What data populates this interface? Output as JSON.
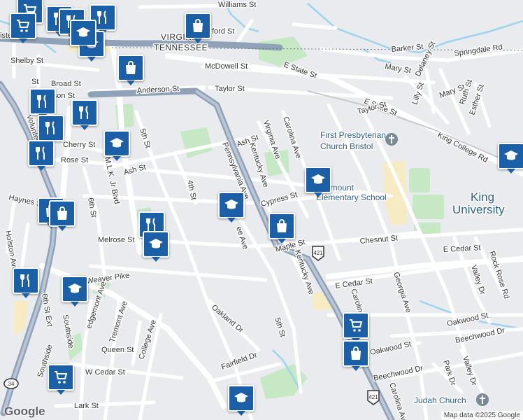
{
  "map": {
    "attribution": "Map data ©2025 Google",
    "logo": "Google",
    "state_labels": [
      "VIRGINIA",
      "TENNESSEE"
    ],
    "streets": [
      "Williams St",
      "ford St",
      "Barker St",
      "Springdale Rd",
      "Mary St",
      "Delaney St",
      "McDowell St",
      "E State St",
      "Shelby St",
      "Broad St",
      "Taylor St",
      "Lilly St",
      "Mary St",
      "Ruth St",
      "Anderson St",
      "E State St",
      "Taylor St",
      "Esther St",
      "erson St",
      "5th St",
      "Ash St",
      "Virginia Ave",
      "Carolina Ave",
      "King College Rd",
      "Cherry St",
      "Rose St",
      "Ash St",
      "Kentucky Ave",
      "Pennsylvania Ave",
      "4th St",
      "6th St",
      "Cypress St",
      "Haynes St",
      "Chesnut St",
      "Maple St",
      "Melrose St",
      "Kentucky Ave",
      "E Cedar St",
      "E Cedar St",
      "Rock Rose Rd",
      "Valley Dr",
      "Holston Ave",
      "Weaver Pike",
      "Carolina Ave",
      "Georgia Ave",
      "Oakland Dr",
      "Oakwood St",
      "Beechwood Dr",
      "Tremont Ave",
      "College Ave",
      "5th St",
      "Queen St",
      "Oakwood St",
      "Park Dr",
      "Valley Dr",
      "W Cedar St",
      "Beechwood Dr",
      "Fairfield Dr",
      "Carolina Ave",
      "Lark St",
      "6th St Ext",
      "Southside",
      "M.L.K. Jr Blvd",
      "Volunteer Pkwy",
      "ee Ave",
      "edgemont Ave",
      "Southside",
      "ister",
      "St"
    ],
    "route_shields": [
      "421",
      "421",
      "34"
    ],
    "pois": [
      {
        "name": "First Presbyterian Church Bristol",
        "line1": "First Presbyterian",
        "line2": "Church Bristol",
        "icon": "church-icon"
      },
      {
        "name": "Fairmount Elementary School",
        "line1": "Fairmount",
        "line2": "Elementary School",
        "icon": "school-icon"
      },
      {
        "name": "King University",
        "line1": "King",
        "line2": "University",
        "icon": "university-icon"
      },
      {
        "name": "Judah Church",
        "line1": "Judah Church",
        "line2": "",
        "icon": "church-icon"
      }
    ],
    "markers": [
      {
        "type": "shopping-cart"
      },
      {
        "type": "restaurant"
      },
      {
        "type": "shopping-cart"
      },
      {
        "type": "restaurant"
      },
      {
        "type": "restaurant"
      },
      {
        "type": "school"
      },
      {
        "type": "shopping-bag"
      },
      {
        "type": "school"
      },
      {
        "type": "shopping-bag"
      },
      {
        "type": "restaurant"
      },
      {
        "type": "restaurant"
      },
      {
        "type": "restaurant"
      },
      {
        "type": "school"
      },
      {
        "type": "restaurant"
      },
      {
        "type": "school"
      },
      {
        "type": "shopping-bag"
      },
      {
        "type": "shopping-bag"
      },
      {
        "type": "school"
      },
      {
        "type": "restaurant"
      },
      {
        "type": "school"
      },
      {
        "type": "restaurant"
      },
      {
        "type": "school"
      },
      {
        "type": "school"
      },
      {
        "type": "shopping-cart"
      },
      {
        "type": "shopping-bag"
      },
      {
        "type": "shopping-cart"
      },
      {
        "type": "school"
      },
      {
        "type": "school"
      }
    ]
  }
}
